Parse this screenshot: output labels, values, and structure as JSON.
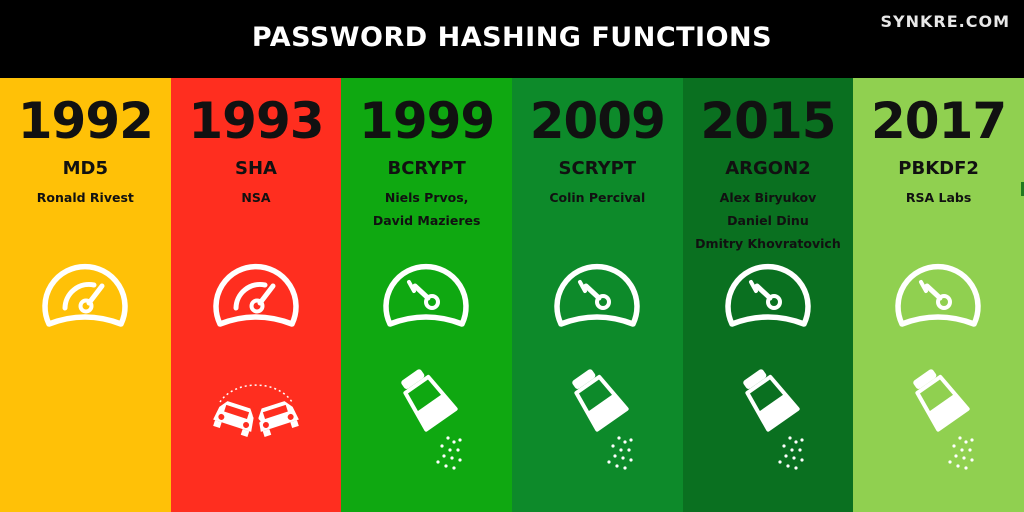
{
  "header": {
    "title": "PASSWORD HASHING FUNCTIONS",
    "brand": "SYNKRE.COM"
  },
  "columns": [
    {
      "year": "1992",
      "name": "MD5",
      "authors": [
        "Ronald Rivest"
      ],
      "background": "#FFC107",
      "gauge": "gauge-high-speed-icon",
      "lower_icon": "none"
    },
    {
      "year": "1993",
      "name": "SHA",
      "authors": [
        "NSA"
      ],
      "background": "#FF2E1F",
      "gauge": "gauge-high-speed-icon",
      "lower_icon": "car-crash-icon"
    },
    {
      "year": "1999",
      "name": "BCRYPT",
      "authors": [
        "Niels Prvos,",
        "David Mazieres"
      ],
      "background": "#0FA811",
      "gauge": "gauge-low-speed-icon",
      "lower_icon": "salt-shaker-icon"
    },
    {
      "year": "2009",
      "name": "SCRYPT",
      "authors": [
        "Colin Percival"
      ],
      "background": "#0D8A2A",
      "gauge": "gauge-low-speed-icon",
      "lower_icon": "salt-shaker-icon"
    },
    {
      "year": "2015",
      "name": "ARGON2",
      "authors": [
        "Alex Biryukov",
        "Daniel Dinu",
        "Dmitry Khovratovich"
      ],
      "background": "#0A7020",
      "gauge": "gauge-low-speed-icon",
      "lower_icon": "salt-shaker-icon"
    },
    {
      "year": "2017",
      "name": "PBKDF2",
      "authors": [
        "RSA Labs"
      ],
      "background": "#90D050",
      "gauge": "gauge-low-speed-icon",
      "lower_icon": "salt-shaker-icon"
    }
  ]
}
